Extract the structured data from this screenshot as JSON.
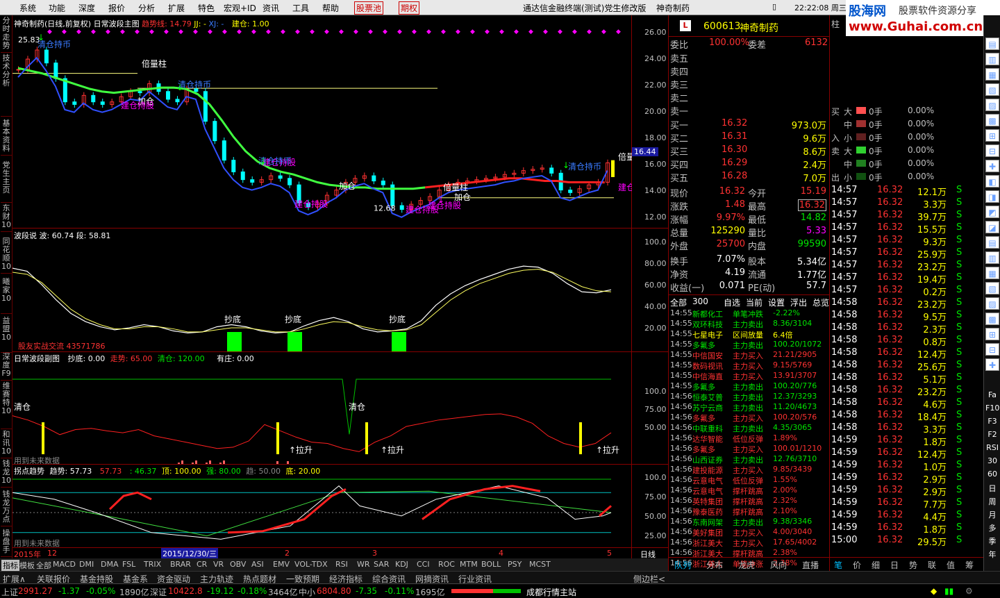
{
  "menu": {
    "items": [
      "系统",
      "功能",
      "深度",
      "报价",
      "分析",
      "扩展",
      "特色",
      "宏观+ID",
      "资讯",
      "工具",
      "帮助"
    ],
    "stock_pool": "股票池",
    "period": "期权",
    "app_title": "通达信金融终端(测试)党生修改版",
    "stock_name": "神奇制药",
    "clock": "22:22:08 周三",
    "logo_text": "股海网",
    "logo_slogan": "股票软件资源分享",
    "logo_url": "www.Guhai.com.cn"
  },
  "left_tabs": [
    "分时走势",
    "技术分析",
    "基本资料",
    "党生主页",
    "东财10",
    "同花顺10",
    "曦家10",
    "益盟10",
    "深度F9",
    "维赛特10",
    "和讯10",
    "钱龙10",
    "钱龙万点",
    "操盘手"
  ],
  "main_chart": {
    "title": "神奇制药(日线,前复权) 日常波段主图",
    "trend_label": "趋势线: 14.79",
    "jj_label": "JJ: -",
    "xj_label": "XJ: -",
    "build_label": "建仓: 1.00",
    "high_label": "25.83",
    "low_label": "12.68",
    "price_tag": "16.44",
    "y_ticks": [
      "26.00",
      "24.00",
      "22.00",
      "20.00",
      "18.00",
      "16.00",
      "14.00",
      "12.00"
    ],
    "annotations": [
      "倍量柱",
      "清仓持币",
      "加仓",
      "建仓持股",
      "清仓持币",
      "建仓持股",
      "建仓持股",
      "加仓",
      "清仓持币",
      "倍量柱",
      "加仓",
      "建仓持股",
      "建仓持股",
      "清仓持币",
      "倍量",
      "建仓"
    ]
  },
  "wave_pane": {
    "title": "波段说 波: 60.74 段: 58.81",
    "y_ticks": [
      "100.0",
      "80.00",
      "60.00",
      "40.00",
      "20.00"
    ],
    "labels": [
      "抄底",
      "抄底",
      "抄底"
    ],
    "watermark": "股友实战交流 43571786"
  },
  "sub_pane": {
    "title": "日常波段副图",
    "values": [
      "抄底: 0.00",
      "走势: 65.00",
      "清仓: 120.00",
      "有庄: 0.00"
    ],
    "y_ticks": [
      "100.0",
      "75.00",
      "50.00"
    ],
    "labels": [
      "清仓",
      "清仓",
      "↑拉升",
      "↑拉升",
      "↑拉升"
    ],
    "future_text": "用到未来数据"
  },
  "turn_pane": {
    "title": "拐点趋势",
    "values": [
      "趋势: 57.73",
      "57.73",
      ": 46.37",
      "顶: 100.00",
      "强: 80.00",
      "趋: 50.00",
      "底: 20.00"
    ],
    "y_ticks": [
      "100.0",
      "75.00",
      "50.00",
      "25.00"
    ],
    "future_text": "用到未来数据"
  },
  "x_axis": {
    "labels": [
      "2015年",
      "12",
      "2015/12/30/三",
      "2",
      "3",
      "4",
      "5"
    ],
    "period_label": "日线"
  },
  "bottom_tabs": [
    "指标",
    "模板",
    "全部",
    "MACD",
    "DMI",
    "DMA",
    "FSL",
    "TRIX",
    "BRAR",
    "CR",
    "VR",
    "OBV",
    "ASI",
    "EMV",
    "VOL-TDX",
    "RSI",
    "WR",
    "SAR",
    "KDJ",
    "CCI",
    "ROC",
    "MTM",
    "BOLL",
    "PSY",
    "MCST"
  ],
  "nav2": [
    "扩展∧",
    "关联报价",
    "基金持股",
    "基金系",
    "资金驱动",
    "主力轨迹",
    "热点题材",
    "一致预期",
    "经济指标",
    "综合资讯",
    "网摘资讯",
    "行业资讯"
  ],
  "nav2_right": "侧边栏<",
  "quote": {
    "code": "600613",
    "name": "神奇制药",
    "weibi_label": "委比",
    "weibi": "100.00%",
    "weicha_label": "委差",
    "weicha": "6132",
    "sells": [
      "卖五",
      "卖四",
      "卖三",
      "卖二",
      "卖一"
    ],
    "buys": [
      {
        "label": "买一",
        "price": "16.32",
        "vol": "973.0万"
      },
      {
        "label": "买二",
        "price": "16.31",
        "vol": "9.6万"
      },
      {
        "label": "买三",
        "price": "16.30",
        "vol": "8.6万"
      },
      {
        "label": "买四",
        "price": "16.29",
        "vol": "2.4万"
      },
      {
        "label": "买五",
        "price": "16.28",
        "vol": "7.0万"
      }
    ],
    "stats": [
      {
        "l1": "现价",
        "v1": "16.32",
        "l2": "今开",
        "v2": "15.19"
      },
      {
        "l1": "涨跌",
        "v1": "1.48",
        "l2": "最高",
        "v2": "16.32"
      },
      {
        "l1": "涨幅",
        "v1": "9.97%",
        "l2": "最低",
        "v2": "14.82"
      },
      {
        "l1": "总量",
        "v1": "125290",
        "l2": "量比",
        "v2": "5.33"
      },
      {
        "l1": "外盘",
        "v1": "25700",
        "l2": "内盘",
        "v2": "99590"
      }
    ],
    "stats2": [
      {
        "l1": "换手",
        "v1": "7.07%",
        "l2": "股本",
        "v2": "5.34亿"
      },
      {
        "l1": "净资",
        "v1": "4.19",
        "l2": "流通",
        "v2": "1.77亿"
      },
      {
        "l1": "收益(一)",
        "v1": "0.071",
        "l2": "PE(动)",
        "v2": "57.7"
      }
    ],
    "news_tabs": [
      "全部",
      "300",
      "自选",
      "当前",
      "设置",
      "浮出",
      "总览"
    ],
    "news": [
      {
        "t": "14:55",
        "n": "新都化工",
        "a": "单笔冲跌",
        "v": "-2.22%"
      },
      {
        "t": "14:55",
        "n": "双环科技",
        "a": "主力卖出",
        "v": "8.36/3104"
      },
      {
        "t": "14:55",
        "n": "七星电子",
        "a": "区间放量",
        "v": "6.4倍"
      },
      {
        "t": "14:55",
        "n": "多氟多",
        "a": "主力卖出",
        "v": "100.20/1072"
      },
      {
        "t": "14:55",
        "n": "中信国安",
        "a": "主力买入",
        "v": "21.21/2905"
      },
      {
        "t": "14:55",
        "n": "数码视讯",
        "a": "主力买入",
        "v": "9.15/5769"
      },
      {
        "t": "14:55",
        "n": "中信海直",
        "a": "主力买入",
        "v": "13.91/3707"
      },
      {
        "t": "14:55",
        "n": "多氟多",
        "a": "主力卖出",
        "v": "100.20/776"
      },
      {
        "t": "14:56",
        "n": "恒泰艾普",
        "a": "主力卖出",
        "v": "12.37/3293"
      },
      {
        "t": "14:56",
        "n": "苏宁云商",
        "a": "主力卖出",
        "v": "11.20/4673"
      },
      {
        "t": "14:56",
        "n": "多氟多",
        "a": "主力买入",
        "v": "100.20/576"
      },
      {
        "t": "14:56",
        "n": "中联重科",
        "a": "主力卖出",
        "v": "4.35/3065"
      },
      {
        "t": "14:56",
        "n": "达华智能",
        "a": "低位反弹",
        "v": "1.89%"
      },
      {
        "t": "14:56",
        "n": "多氟多",
        "a": "主力买入",
        "v": "100.01/1210"
      },
      {
        "t": "14:56",
        "n": "山西证券",
        "a": "主力卖出",
        "v": "12.76/3710"
      },
      {
        "t": "14:56",
        "n": "建投能源",
        "a": "主力买入",
        "v": "9.85/3439"
      },
      {
        "t": "14:56",
        "n": "云意电气",
        "a": "低位反弹",
        "v": "1.55%"
      },
      {
        "t": "14:56",
        "n": "云意电气",
        "a": "撑杆跳高",
        "v": "2.00%"
      },
      {
        "t": "14:56",
        "n": "英特集团",
        "a": "撑杆跳高",
        "v": "2.32%"
      },
      {
        "t": "14:56",
        "n": "豫泰医药",
        "a": "撑杆跳高",
        "v": "2.10%"
      },
      {
        "t": "14:56",
        "n": "东南网架",
        "a": "主力卖出",
        "v": "9.38/3346"
      },
      {
        "t": "14:56",
        "n": "美好集团",
        "a": "主力买入",
        "v": "4.00/3040"
      },
      {
        "t": "14:56",
        "n": "浙江美大",
        "a": "主力买入",
        "v": "17.65/4002"
      },
      {
        "t": "14:56",
        "n": "浙江美大",
        "a": "撑杆跳高",
        "v": "2.38%"
      },
      {
        "t": "14:56",
        "n": "浙江美大",
        "a": "单笔冲涨",
        "v": "2.38%"
      }
    ],
    "bottom_tabs": [
      "队列",
      "分布",
      "龙虎",
      "风向",
      "直播"
    ]
  },
  "ticks": {
    "header": "柱",
    "flow": [
      {
        "side": "买",
        "size": "大",
        "val": "0手",
        "pct": "0.00%",
        "color": "#ff5050"
      },
      {
        "side": "",
        "size": "中",
        "val": "0手",
        "pct": "0.00%",
        "color": "#a03030"
      },
      {
        "side": "入",
        "size": "小",
        "val": "0手",
        "pct": "0.00%",
        "color": "#602020"
      },
      {
        "side": "卖",
        "size": "大",
        "val": "0手",
        "pct": "0.00%",
        "color": "#30d030"
      },
      {
        "side": "",
        "size": "中",
        "val": "0手",
        "pct": "0.00%",
        "color": "#208020"
      },
      {
        "side": "出",
        "size": "小",
        "val": "0手",
        "pct": "0.00%",
        "color": "#105010"
      }
    ],
    "rows": [
      {
        "t": "14:57",
        "p": "16.32",
        "v": "12.1万",
        "s": "S"
      },
      {
        "t": "14:57",
        "p": "16.32",
        "v": "3.3万",
        "s": "S"
      },
      {
        "t": "14:57",
        "p": "16.32",
        "v": "39.7万",
        "s": "S"
      },
      {
        "t": "14:57",
        "p": "16.32",
        "v": "15.5万",
        "s": "S"
      },
      {
        "t": "14:57",
        "p": "16.32",
        "v": "9.3万",
        "s": "S"
      },
      {
        "t": "14:57",
        "p": "16.32",
        "v": "25.9万",
        "s": "S"
      },
      {
        "t": "14:57",
        "p": "16.32",
        "v": "23.2万",
        "s": "S"
      },
      {
        "t": "14:57",
        "p": "16.32",
        "v": "19.4万",
        "s": "S"
      },
      {
        "t": "14:57",
        "p": "16.32",
        "v": "0.2万",
        "s": "S"
      },
      {
        "t": "14:58",
        "p": "16.32",
        "v": "23.2万",
        "s": "S"
      },
      {
        "t": "14:58",
        "p": "16.32",
        "v": "9.5万",
        "s": "S"
      },
      {
        "t": "14:58",
        "p": "16.32",
        "v": "2.3万",
        "s": "S"
      },
      {
        "t": "14:58",
        "p": "16.32",
        "v": "0.8万",
        "s": "S"
      },
      {
        "t": "14:58",
        "p": "16.32",
        "v": "12.4万",
        "s": "S"
      },
      {
        "t": "14:58",
        "p": "16.32",
        "v": "25.6万",
        "s": "S"
      },
      {
        "t": "14:58",
        "p": "16.32",
        "v": "5.1万",
        "s": "S"
      },
      {
        "t": "14:58",
        "p": "16.32",
        "v": "23.2万",
        "s": "S"
      },
      {
        "t": "14:58",
        "p": "16.32",
        "v": "4.6万",
        "s": "S"
      },
      {
        "t": "14:58",
        "p": "16.32",
        "v": "18.4万",
        "s": "S"
      },
      {
        "t": "14:58",
        "p": "16.32",
        "v": "3.3万",
        "s": "S"
      },
      {
        "t": "14:59",
        "p": "16.32",
        "v": "1.8万",
        "s": "S"
      },
      {
        "t": "14:59",
        "p": "16.32",
        "v": "12.4万",
        "s": "S"
      },
      {
        "t": "14:59",
        "p": "16.32",
        "v": "1.0万",
        "s": "S"
      },
      {
        "t": "14:59",
        "p": "16.32",
        "v": "2.9万",
        "s": "S"
      },
      {
        "t": "14:59",
        "p": "16.32",
        "v": "2.9万",
        "s": "S"
      },
      {
        "t": "14:59",
        "p": "16.32",
        "v": "7.7万",
        "s": "S"
      },
      {
        "t": "14:59",
        "p": "16.32",
        "v": "4.4万",
        "s": "S"
      },
      {
        "t": "14:59",
        "p": "16.32",
        "v": "1.8万",
        "s": "S"
      },
      {
        "t": "15:00",
        "p": "16.32",
        "v": "29.5万",
        "s": "S"
      }
    ],
    "bottom_tabs": [
      "笔",
      "价",
      "细",
      "日",
      "势",
      "联",
      "值",
      "筹"
    ]
  },
  "right_icons": [
    "Fa",
    "F10",
    "F3",
    "F2",
    "RSI",
    "30",
    "60",
    "日",
    "周",
    "月",
    "多",
    "季",
    "年"
  ],
  "status": {
    "sh_label": "上证",
    "sh_val": "2991.27",
    "sh_chg": "-1.37",
    "sh_pct": "-0.05%",
    "sh_amt": "1890亿",
    "sz_label": "深证",
    "sz_val": "10422.8",
    "sz_chg": "-19.12",
    "sz_pct": "-0.18%",
    "sz_amt": "3464亿",
    "zx_label": "中小",
    "zx_val": "6804.80",
    "zx_chg": "-7.35",
    "zx_pct": "-0.11%",
    "zx_amt": "1695亿",
    "server": "成都行情主站"
  },
  "chart_data": {
    "type": "candlestick",
    "title": "神奇制药(日线,前复权) 日常波段主图",
    "ylim": [
      11.5,
      26.5
    ],
    "price_path": [
      23.5,
      24.3,
      25.0,
      24.0,
      22.8,
      21.0,
      20.8,
      21.5,
      21.0,
      20.8,
      21.0,
      21.4,
      21.8,
      21.7,
      22.4,
      21.8,
      21.2,
      21.0,
      22.0,
      21.8,
      19.5,
      18.0,
      16.5,
      15.6,
      15.0,
      14.8,
      15.0,
      15.3,
      15.1,
      14.6,
      13.2,
      12.9,
      13.2,
      13.8,
      14.2,
      14.8,
      15.1,
      15.3,
      14.9,
      14.6,
      13.0,
      12.7,
      13.1,
      13.4,
      13.7,
      14.2,
      14.6,
      14.8,
      14.9,
      15.0,
      15.1,
      15.2,
      15.4,
      15.5,
      15.7,
      15.8,
      15.9,
      15.5,
      14.2,
      14.0,
      14.3,
      14.6,
      14.8,
      16.3
    ],
    "trend_line": [
      23.6,
      23.4,
      23.2,
      22.9,
      22.6,
      22.3,
      22.0,
      21.8,
      21.7,
      21.8,
      21.9,
      22.0,
      22.1,
      22.1,
      22.0,
      21.6,
      20.8,
      19.6,
      18.3,
      17.2,
      16.4,
      15.9,
      15.6,
      15.4,
      15.1,
      14.8,
      14.6,
      14.5,
      14.4,
      14.4,
      14.3,
      14.3,
      14.3,
      14.3,
      14.4,
      14.5,
      14.6,
      14.7,
      14.8,
      14.9,
      15.0,
      15.1,
      15.1,
      15.0,
      14.9,
      14.9,
      14.8,
      14.8,
      14.8,
      14.79
    ],
    "wave": [
      81,
      78,
      65,
      50,
      37,
      29,
      24,
      21,
      23,
      26,
      24,
      20,
      18,
      19,
      24,
      26,
      24,
      20,
      18,
      19,
      25,
      30,
      33,
      29,
      22,
      19,
      20,
      22,
      30,
      45,
      56,
      64,
      70,
      75,
      80,
      83,
      82,
      76,
      66,
      58,
      57,
      60
    ],
    "wave2": [
      77,
      75,
      67,
      54,
      41,
      32,
      26,
      22,
      22,
      24,
      24,
      22,
      19,
      19,
      21,
      23,
      23,
      21,
      19,
      19,
      22,
      26,
      29,
      28,
      24,
      21,
      20,
      21,
      26,
      38,
      50,
      59,
      66,
      71,
      76,
      79,
      80,
      77,
      70,
      63,
      59,
      58
    ],
    "subpane_line": [
      92,
      85,
      75,
      62,
      70,
      72,
      68,
      65,
      70,
      60,
      55,
      50,
      45,
      40,
      42,
      52,
      78,
      68,
      58,
      50,
      48,
      40,
      35,
      50,
      60,
      75,
      80,
      85,
      88,
      91,
      94,
      95,
      90,
      80,
      60,
      48,
      42,
      48,
      65
    ]
  }
}
